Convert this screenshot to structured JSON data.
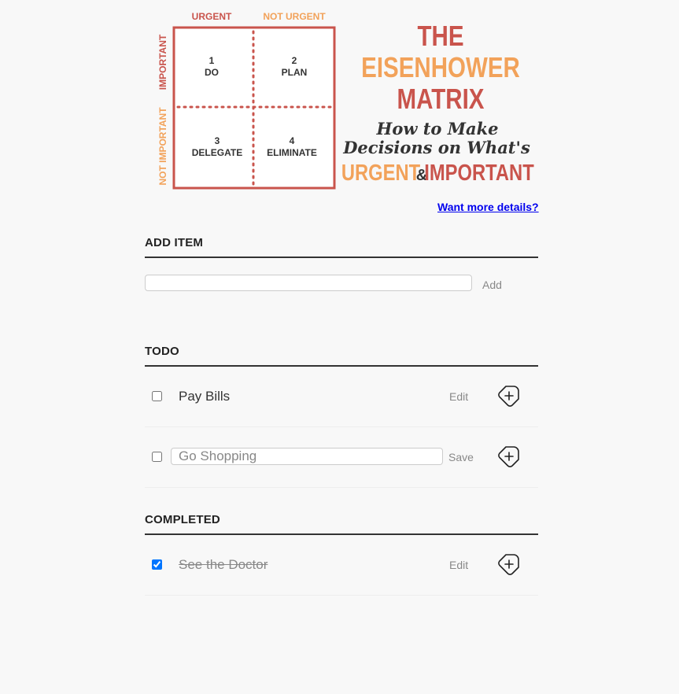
{
  "banner": {
    "matrix": {
      "col_urgent": "URGENT",
      "col_not_urgent": "NOT URGENT",
      "row_important": "IMPORTANT",
      "row_not_important": "NOT IMPORTANT",
      "q1_num": "1",
      "q1_label": "DO",
      "q2_num": "2",
      "q2_label": "PLAN",
      "q3_num": "3",
      "q3_label": "DELEGATE",
      "q4_num": "4",
      "q4_label": "ELIMINATE"
    },
    "title_the": "THE",
    "title_eisenhower": "EISENHOWER",
    "title_matrix": "MATRIX",
    "subtitle_line1": "How to Make",
    "subtitle_line2": "Decisions on What's",
    "tagline_urgent": "URGENT",
    "tagline_amp": "&",
    "tagline_important": "IMPORTANT"
  },
  "details_link": "Want more details?",
  "add_item": {
    "title": "ADD ITEM",
    "input_value": "",
    "add_label": "Add"
  },
  "todo": {
    "title": "TODO",
    "items": [
      {
        "label": "Pay Bills",
        "action": "Edit",
        "checked": false,
        "editing": false
      },
      {
        "label": "Go Shopping",
        "action": "Save",
        "checked": false,
        "editing": true
      }
    ]
  },
  "completed": {
    "title": "COMPLETED",
    "items": [
      {
        "label": "See the Doctor",
        "action": "Edit",
        "checked": true
      }
    ]
  },
  "colors": {
    "red": "#c9544c",
    "orange": "#f2a25a",
    "link": "#0000ee"
  }
}
